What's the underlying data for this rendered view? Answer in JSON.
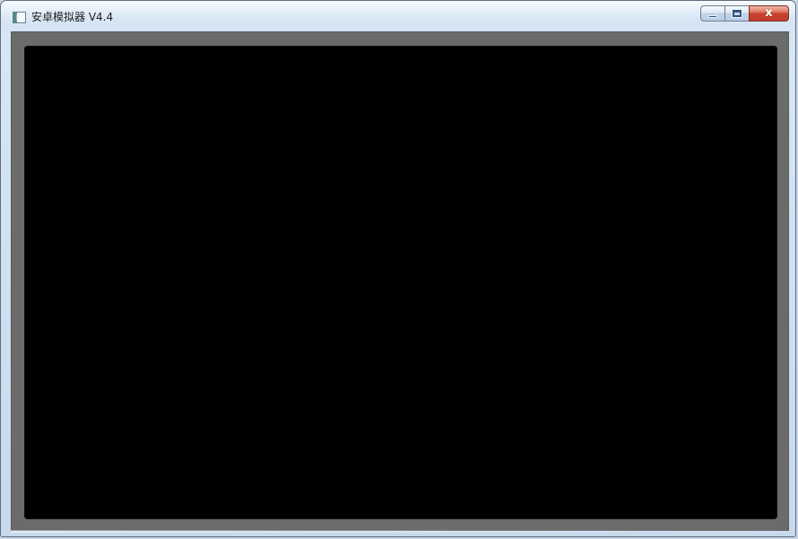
{
  "window": {
    "title": "安卓模拟器 V4.4",
    "close_label": "x",
    "colors": {
      "frame": "#6b6b6b",
      "display": "#000000",
      "close": "#c9452f"
    }
  }
}
